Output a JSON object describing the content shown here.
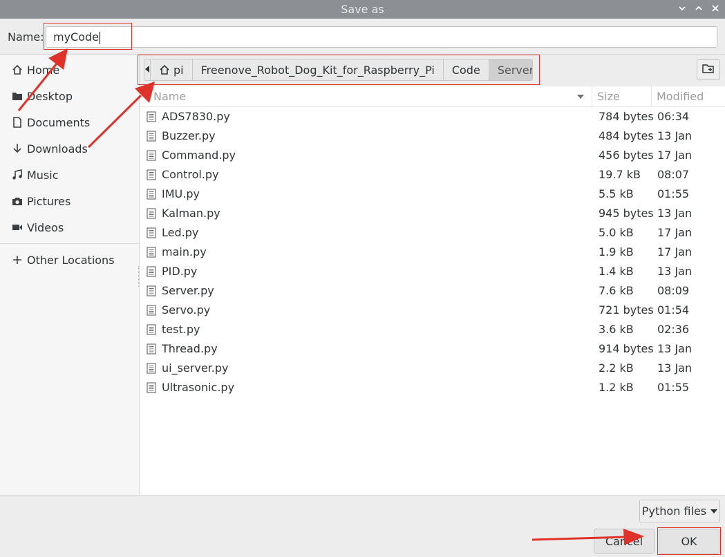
{
  "window": {
    "title": "Save as"
  },
  "name_row": {
    "label": "Name:",
    "value": "myCode"
  },
  "sidebar": {
    "items": [
      {
        "label": "Home",
        "icon": "home-icon"
      },
      {
        "label": "Desktop",
        "icon": "folder-icon"
      },
      {
        "label": "Documents",
        "icon": "document-icon"
      },
      {
        "label": "Downloads",
        "icon": "download-icon"
      },
      {
        "label": "Music",
        "icon": "music-icon"
      },
      {
        "label": "Pictures",
        "icon": "camera-icon"
      },
      {
        "label": "Videos",
        "icon": "video-icon"
      }
    ],
    "other_locations": "Other Locations"
  },
  "path_bar": {
    "segments": [
      "pi",
      "Freenove_Robot_Dog_Kit_for_Raspberry_Pi",
      "Code",
      "Server"
    ],
    "active": "Server"
  },
  "file_list": {
    "columns": {
      "name": "Name",
      "size": "Size",
      "modified": "Modified"
    },
    "rows": [
      {
        "name": "ADS7830.py",
        "size": "784 bytes",
        "modified": "06:34"
      },
      {
        "name": "Buzzer.py",
        "size": "484 bytes",
        "modified": "13 Jan"
      },
      {
        "name": "Command.py",
        "size": "456 bytes",
        "modified": "17 Jan"
      },
      {
        "name": "Control.py",
        "size": "19.7 kB",
        "modified": "08:07"
      },
      {
        "name": "IMU.py",
        "size": "5.5 kB",
        "modified": "01:55"
      },
      {
        "name": "Kalman.py",
        "size": "945 bytes",
        "modified": "13 Jan"
      },
      {
        "name": "Led.py",
        "size": "5.0 kB",
        "modified": "17 Jan"
      },
      {
        "name": "main.py",
        "size": "1.9 kB",
        "modified": "17 Jan"
      },
      {
        "name": "PID.py",
        "size": "1.4 kB",
        "modified": "13 Jan"
      },
      {
        "name": "Server.py",
        "size": "7.6 kB",
        "modified": "08:09"
      },
      {
        "name": "Servo.py",
        "size": "721 bytes",
        "modified": "01:54"
      },
      {
        "name": "test.py",
        "size": "3.6 kB",
        "modified": "02:36"
      },
      {
        "name": "Thread.py",
        "size": "914 bytes",
        "modified": "13 Jan"
      },
      {
        "name": "ui_server.py",
        "size": "2.2 kB",
        "modified": "13 Jan"
      },
      {
        "name": "Ultrasonic.py",
        "size": "1.2 kB",
        "modified": "01:55"
      }
    ]
  },
  "footer": {
    "filter_label": "Python files",
    "cancel_label": "Cancel",
    "ok_label": "OK"
  },
  "colors": {
    "annotation": "#e0312b",
    "titlebar": "#8c9094"
  }
}
